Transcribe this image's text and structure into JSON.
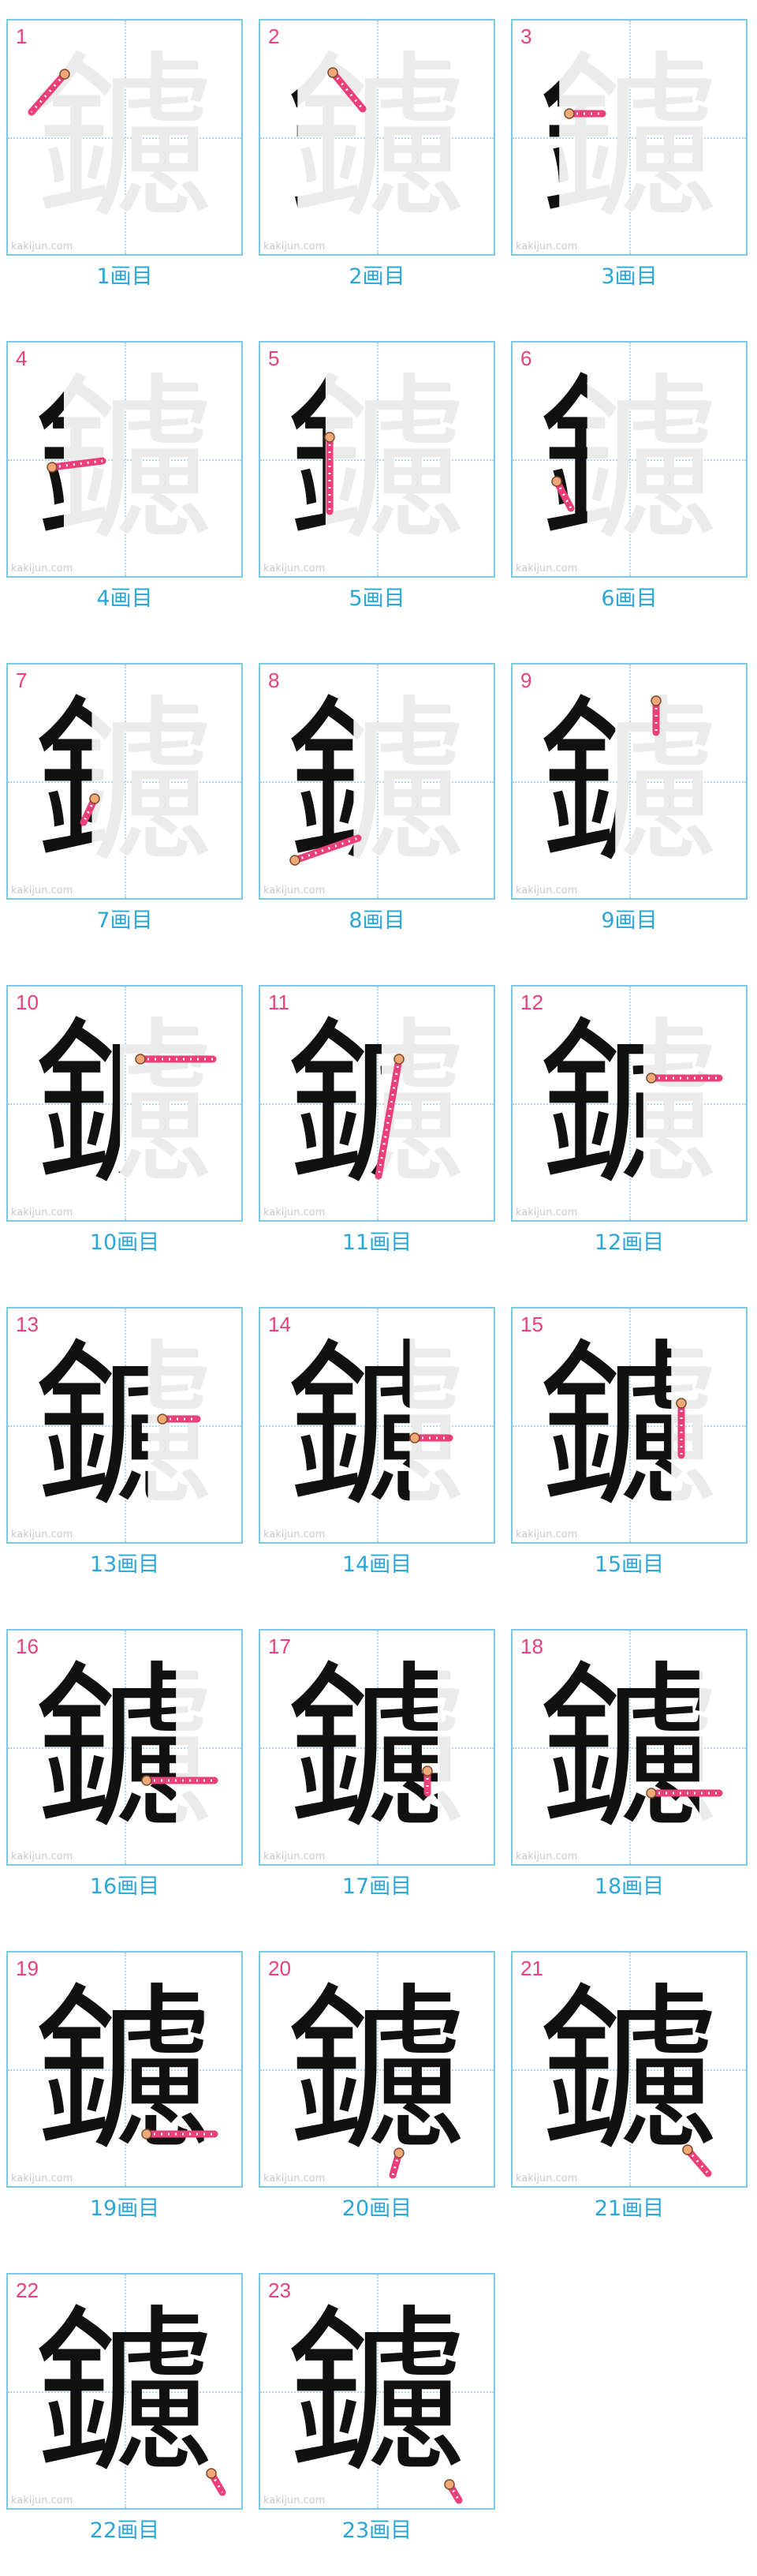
{
  "kanji": "鑢",
  "watermark": "kakijun.com",
  "colors": {
    "stroke_highlight": "#ea3f7b",
    "stroke_start_dot": "#f0a878",
    "frame": "#7fc7e6",
    "ghost": "#ebebeb",
    "caption": "#2aa6d8",
    "number": "#ea3f7b"
  },
  "steps": [
    {
      "number": "1",
      "caption": "1画目"
    },
    {
      "number": "2",
      "caption": "2画目"
    },
    {
      "number": "3",
      "caption": "3画目"
    },
    {
      "number": "4",
      "caption": "4画目"
    },
    {
      "number": "5",
      "caption": "5画目"
    },
    {
      "number": "6",
      "caption": "6画目"
    },
    {
      "number": "7",
      "caption": "7画目"
    },
    {
      "number": "8",
      "caption": "8画目"
    },
    {
      "number": "9",
      "caption": "9画目"
    },
    {
      "number": "10",
      "caption": "10画目"
    },
    {
      "number": "11",
      "caption": "11画目"
    },
    {
      "number": "12",
      "caption": "12画目"
    },
    {
      "number": "13",
      "caption": "13画目"
    },
    {
      "number": "14",
      "caption": "14画目"
    },
    {
      "number": "15",
      "caption": "15画目"
    },
    {
      "number": "16",
      "caption": "16画目"
    },
    {
      "number": "17",
      "caption": "17画目"
    },
    {
      "number": "18",
      "caption": "18画目"
    },
    {
      "number": "19",
      "caption": "19画目"
    },
    {
      "number": "20",
      "caption": "20画目"
    },
    {
      "number": "21",
      "caption": "21画目"
    },
    {
      "number": "22",
      "caption": "22画目"
    },
    {
      "number": "23",
      "caption": "23画目"
    }
  ]
}
